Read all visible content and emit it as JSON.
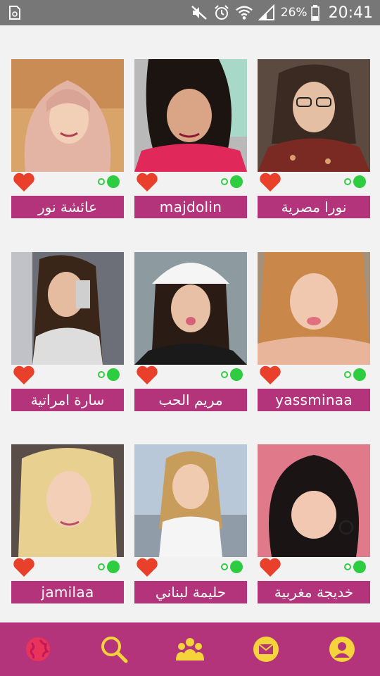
{
  "status_bar": {
    "battery_percent": "26%",
    "time": "20:41",
    "icons": [
      "sim-toolkit-icon",
      "mute-icon",
      "alarm-icon",
      "wifi-icon",
      "signal-icon",
      "battery-icon"
    ]
  },
  "profiles": [
    {
      "name": "عائشة نور",
      "liked": true,
      "online": true
    },
    {
      "name": "majdolin",
      "liked": true,
      "online": true
    },
    {
      "name": "نورا مصرية",
      "liked": true,
      "online": true
    },
    {
      "name": "سارة امراتية",
      "liked": true,
      "online": true
    },
    {
      "name": "مريم الحب",
      "liked": true,
      "online": true
    },
    {
      "name": "yassminaa",
      "liked": true,
      "online": true
    },
    {
      "name": "jamilaa",
      "liked": true,
      "online": true
    },
    {
      "name": "حليمة لبناني",
      "liked": true,
      "online": true
    },
    {
      "name": "خديجة مغربية",
      "liked": true,
      "online": true
    }
  ],
  "bottom_nav": [
    {
      "icon": "globe-icon",
      "active": true
    },
    {
      "icon": "search-icon",
      "active": false
    },
    {
      "icon": "group-icon",
      "active": false
    },
    {
      "icon": "mail-icon",
      "active": false
    },
    {
      "icon": "profile-icon",
      "active": false
    }
  ],
  "colors": {
    "accent": "#b3347a",
    "nav_icon": "#f5d33a",
    "nav_active": "#e8335a",
    "heart": "#e8402a",
    "online": "#2ecc40",
    "status_bar": "#777777"
  }
}
